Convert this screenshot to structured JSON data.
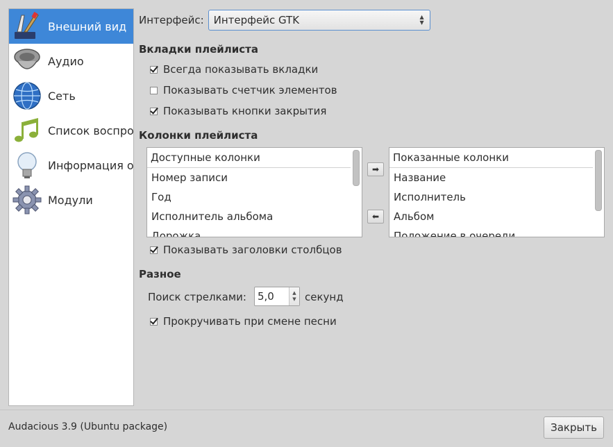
{
  "sidebar": {
    "items": [
      {
        "label": "Внешний вид",
        "icon": "paintbrush-icon",
        "selected": true
      },
      {
        "label": "Аудио",
        "icon": "speaker-icon",
        "selected": false
      },
      {
        "label": "Сеть",
        "icon": "globe-icon",
        "selected": false
      },
      {
        "label": "Список воспроизведения",
        "icon": "music-note-icon",
        "selected": false
      },
      {
        "label": "Информация о песне",
        "icon": "lightbulb-icon",
        "selected": false
      },
      {
        "label": "Модули",
        "icon": "gear-icon",
        "selected": false
      }
    ]
  },
  "interface": {
    "label": "Интерфейс:",
    "value": "Интерфейс GTK"
  },
  "tabs_section": {
    "title": "Вкладки плейлиста",
    "options": [
      {
        "label": "Всегда показывать вкладки",
        "checked": true
      },
      {
        "label": "Показывать счетчик элементов",
        "checked": false
      },
      {
        "label": "Показывать кнопки закрытия",
        "checked": true
      }
    ]
  },
  "columns_section": {
    "title": "Колонки плейлиста",
    "available": {
      "header": "Доступные колонки",
      "items": [
        "Номер записи",
        "Год",
        "Исполнитель альбома",
        "Дорожка"
      ]
    },
    "shown": {
      "header": "Показанные колонки",
      "items": [
        "Название",
        "Исполнитель",
        "Альбом",
        "Положение в очереди"
      ]
    },
    "show_headers": {
      "label": "Показывать заголовки столбцов",
      "checked": true
    }
  },
  "misc_section": {
    "title": "Разное",
    "seek_label": "Поиск стрелками:",
    "seek_value": "5,0",
    "seek_unit": "секунд",
    "scroll_option": {
      "label": "Прокручивать при смене песни",
      "checked": true
    }
  },
  "footer": {
    "version": "Audacious 3.9 (Ubuntu package)",
    "close_label": "Закрыть"
  },
  "colors": {
    "selection": "#3e87d8",
    "background": "#d6d6d6"
  }
}
